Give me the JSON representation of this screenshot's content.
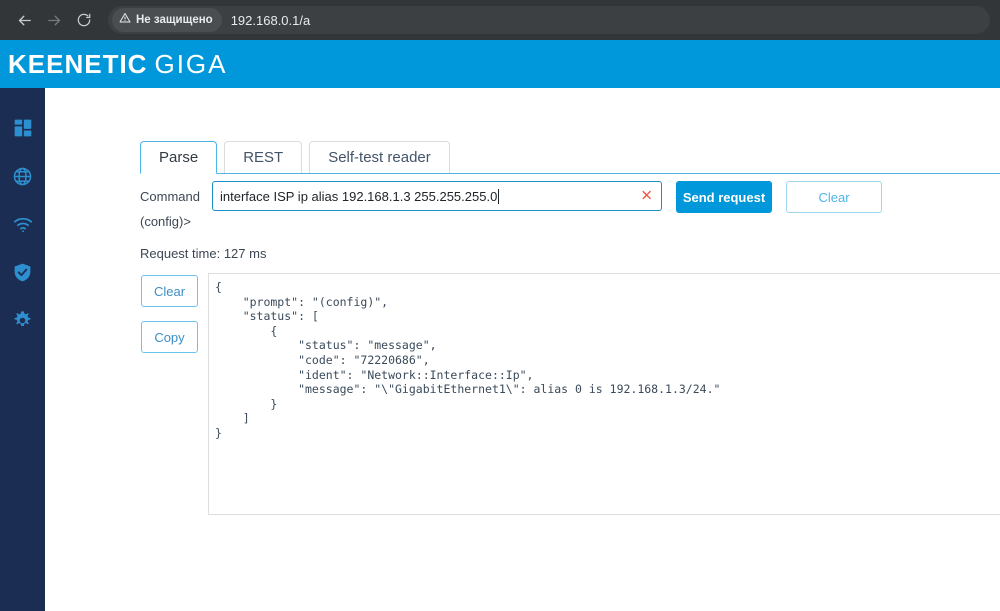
{
  "browser": {
    "back_icon": "back-arrow-icon",
    "forward_icon": "forward-arrow-icon",
    "reload_icon": "reload-icon",
    "security_label": "Не защищено",
    "security_icon": "warning-triangle-icon",
    "url": "192.168.0.1/a"
  },
  "header": {
    "brand": "KEENETIC",
    "model": "GIGA",
    "accent_color": "#0098da"
  },
  "sidebar": {
    "background_color": "#1b2d52",
    "items": [
      {
        "icon": "dashboard-grid-icon",
        "name": "dashboard"
      },
      {
        "icon": "globe-icon",
        "name": "internet"
      },
      {
        "icon": "wifi-icon",
        "name": "wifi"
      },
      {
        "icon": "shield-check-icon",
        "name": "security"
      },
      {
        "icon": "gear-icon",
        "name": "settings"
      }
    ]
  },
  "tabs": [
    {
      "label": "Parse",
      "active": true
    },
    {
      "label": "REST",
      "active": false
    },
    {
      "label": "Self-test reader",
      "active": false
    }
  ],
  "command": {
    "label": "Command",
    "value": "interface ISP ip alias 192.168.1.3 255.255.255.0",
    "placeholder": "",
    "clear_icon": "close-x-icon",
    "send_label": "Send request",
    "clear_label": "Clear"
  },
  "prompt": "(config)>",
  "request_time": "Request time: 127 ms",
  "output_controls": {
    "clear_label": "Clear",
    "copy_label": "Copy"
  },
  "output": {
    "text": "{\n    \"prompt\": \"(config)\",\n    \"status\": [\n        {\n            \"status\": \"message\",\n            \"code\": \"72220686\",\n            \"ident\": \"Network::Interface::Ip\",\n            \"message\": \"\\\"GigabitEthernet1\\\": alias 0 is 192.168.1.3/24.\"\n        }\n    ]\n}"
  }
}
